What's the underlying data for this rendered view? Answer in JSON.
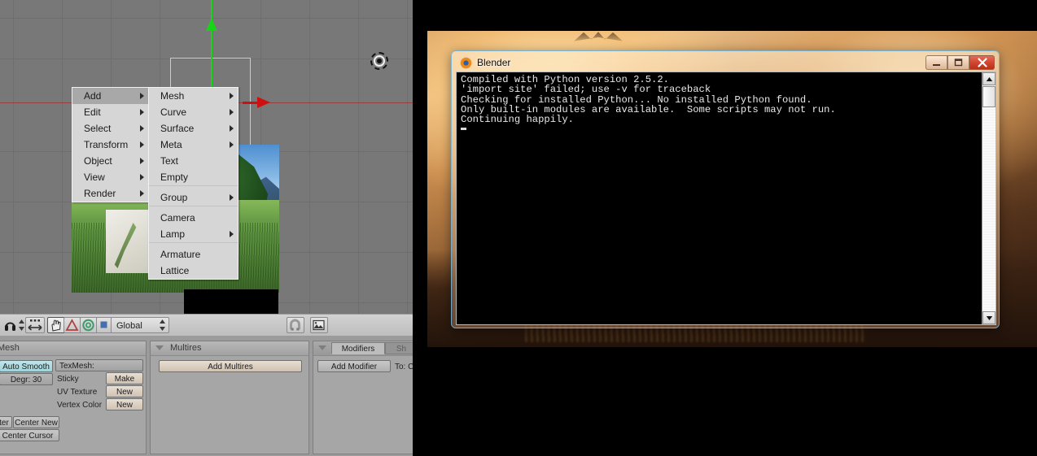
{
  "blender": {
    "viewport": {
      "name": "3d-viewport",
      "cursor_icon": "3d-cursor-icon",
      "axis_z_icon": "z-axis-arrow-icon",
      "axis_x_icon": "x-axis-arrow-icon",
      "cube_label": "selected-cube-outline"
    },
    "menu": {
      "column1": [
        {
          "label": "Add",
          "submenu": true,
          "highlighted": true
        },
        {
          "label": "Edit",
          "submenu": true,
          "highlighted": false
        },
        {
          "label": "Select",
          "submenu": true,
          "highlighted": false
        },
        {
          "label": "Transform",
          "submenu": true,
          "highlighted": false
        },
        {
          "label": "Object",
          "submenu": true,
          "highlighted": false
        },
        {
          "label": "View",
          "submenu": true,
          "highlighted": false
        },
        {
          "label": "Render",
          "submenu": true,
          "highlighted": false
        }
      ],
      "column2": [
        {
          "label": "Mesh",
          "submenu": true,
          "separator_after": false
        },
        {
          "label": "Curve",
          "submenu": true,
          "separator_after": false
        },
        {
          "label": "Surface",
          "submenu": true,
          "separator_after": false
        },
        {
          "label": "Meta",
          "submenu": true,
          "separator_after": false
        },
        {
          "label": "Text",
          "submenu": false,
          "separator_after": false
        },
        {
          "label": "Empty",
          "submenu": false,
          "separator_after": true
        },
        {
          "label": "Group",
          "submenu": true,
          "separator_after": true
        },
        {
          "label": "Camera",
          "submenu": false,
          "separator_after": false
        },
        {
          "label": "Lamp",
          "submenu": true,
          "separator_after": true
        },
        {
          "label": "Armature",
          "submenu": false,
          "separator_after": false
        },
        {
          "label": "Lattice",
          "submenu": false,
          "separator_after": false
        }
      ]
    },
    "toolbar": {
      "mode_icon": "object-mode-icon",
      "stepper_icon": "updown-stepper-icon",
      "viewport_move_icon": "move-arrows-icon",
      "manipulator_hand_icon": "hand-translate-icon",
      "manipulator_rotate_icon": "rotate-triangle-icon",
      "manipulator_scale_icon": "scale-circle-icon",
      "manipulator_square_icon": "square-widget-icon",
      "orientation_value": "Global",
      "orientation_arrows_icon": "updown-stepper-icon",
      "snap_icon": "magnet-snap-icon",
      "render_icon": "render-image-icon"
    },
    "properties": {
      "mesh_panel": {
        "title": "Mesh",
        "auto_smooth": "Auto Smooth",
        "degr": "Degr: 30",
        "center_partial": "ter",
        "center_new": "Center New",
        "center_cursor": "Center Cursor",
        "texmesh": "TexMesh:",
        "rows": [
          {
            "label": "Sticky",
            "button": "Make"
          },
          {
            "label": "UV Texture",
            "button": "New"
          },
          {
            "label": "Vertex Color",
            "button": "New"
          }
        ]
      },
      "multires_panel": {
        "title": "Multires",
        "add_button": "Add Multires"
      },
      "modifiers_panel": {
        "title": "Modifiers",
        "shapes_tab": "Sh",
        "add_button": "Add Modifier",
        "to_label": "To: Cub"
      }
    }
  },
  "desktop": {
    "console_window": {
      "title": "Blender",
      "app_icon": "blender-logo-icon",
      "minimize_icon": "minimize-icon",
      "maximize_icon": "maximize-icon",
      "close_icon": "close-icon",
      "scroll_up_icon": "scroll-up-arrow-icon",
      "scroll_down_icon": "scroll-down-arrow-icon",
      "output": "Compiled with Python version 2.5.2.\n'import site' failed; use -v for traceback\nChecking for installed Python... No installed Python found.\nOnly built-in modules are available.  Some scripts may not run.\nContinuing happily."
    }
  },
  "colors": {
    "menu_highlight": "#a8a8a8",
    "menu_bg": "#d6d6d6",
    "axis_z": "#17d417",
    "axis_x": "#d01010",
    "cube_outline": "#e8b8e8",
    "console_bg": "#000000",
    "console_text": "#e8e8e8",
    "close_button": "#d24630",
    "window_border": "#6eb4dc",
    "auto_smooth_active": "#9fd4da"
  }
}
